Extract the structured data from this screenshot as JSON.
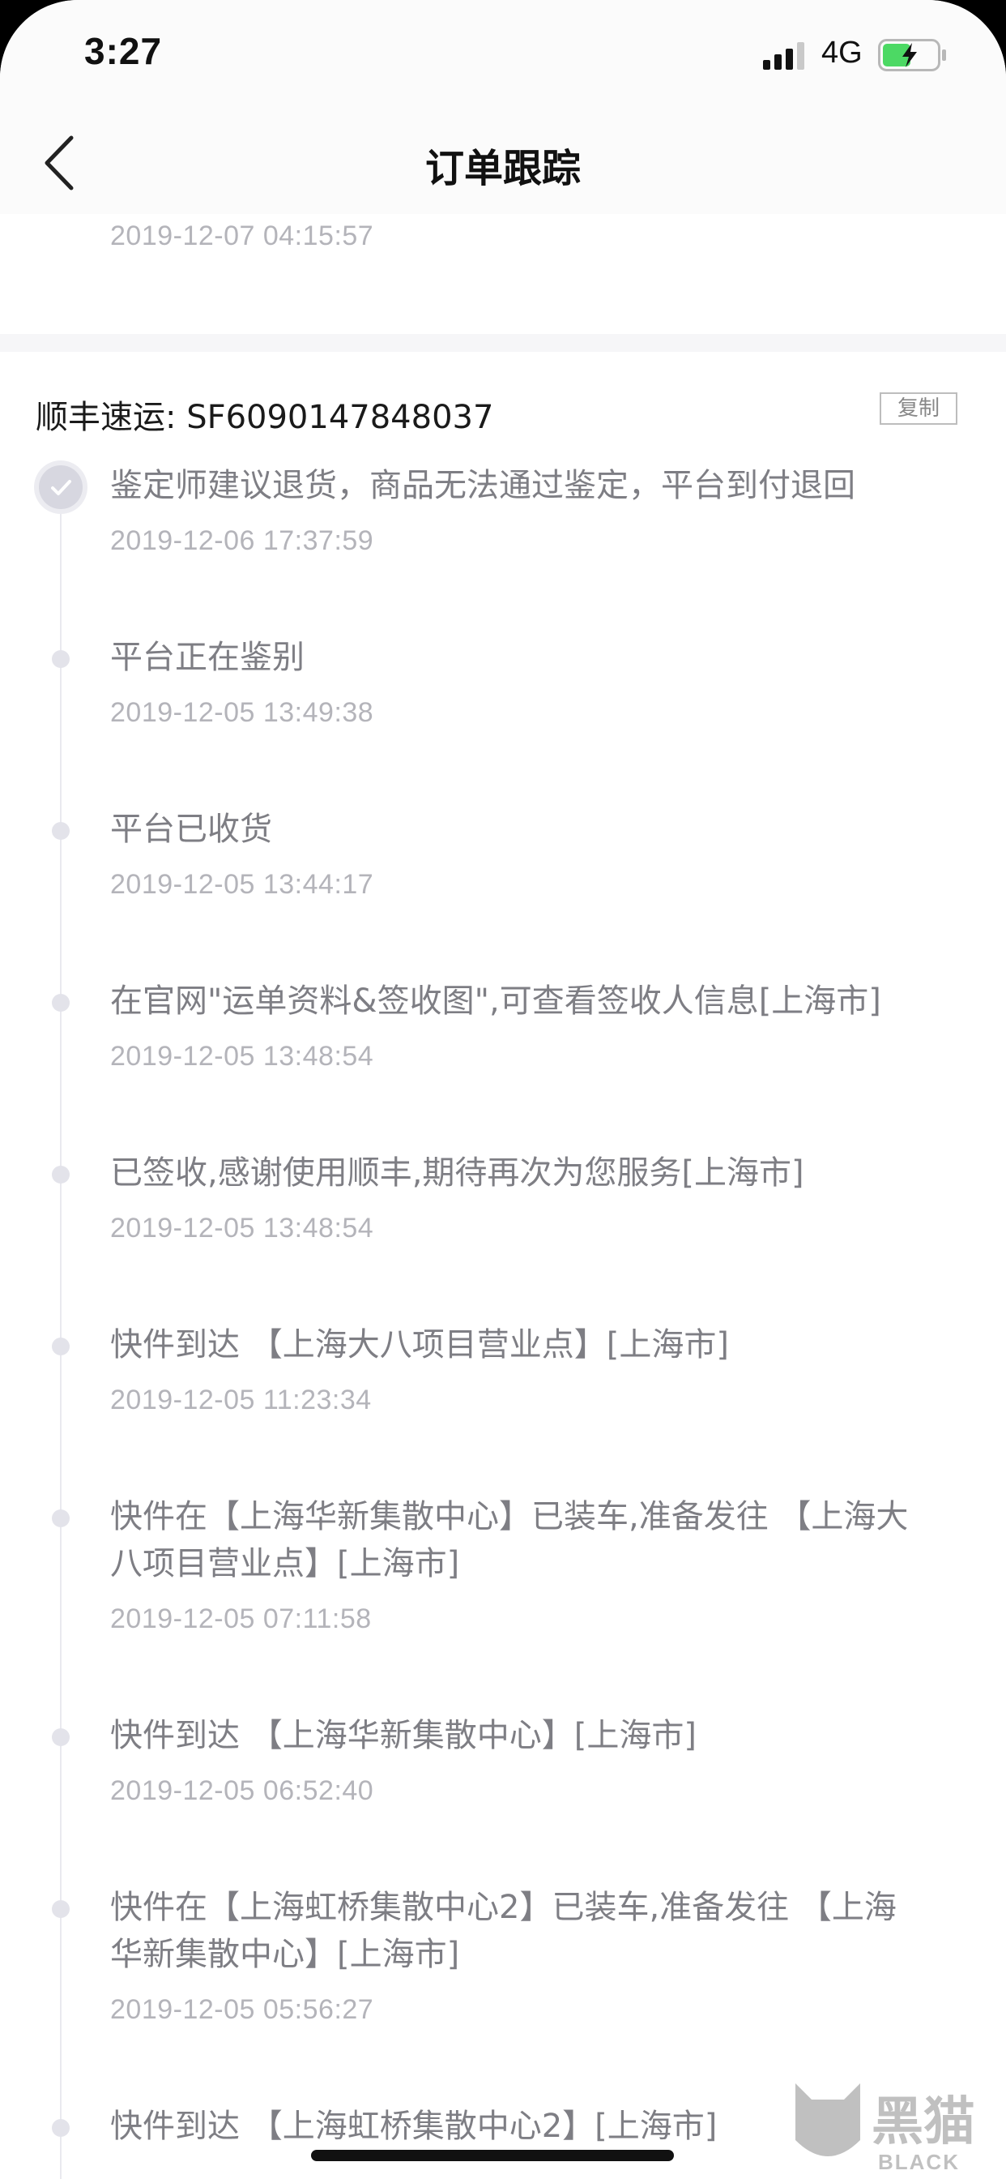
{
  "status_bar": {
    "time": "3:27",
    "network": "4G"
  },
  "nav": {
    "title": "订单跟踪"
  },
  "partial_group": {
    "last_event_time": "2019-12-07 04:15:57"
  },
  "shipment": {
    "carrier_label": "顺丰速运: SF6090147848037",
    "copy_label": "复制",
    "events": [
      {
        "desc": "鉴定师建议退货，商品无法通过鉴定，平台到付退回",
        "time": "2019-12-06 17:37:59"
      },
      {
        "desc": "平台正在鉴别",
        "time": "2019-12-05 13:49:38"
      },
      {
        "desc": "平台已收货",
        "time": "2019-12-05 13:44:17"
      },
      {
        "desc": "在官网\"运单资料&签收图\",可查看签收人信息[上海市]",
        "time": "2019-12-05 13:48:54"
      },
      {
        "desc": "已签收,感谢使用顺丰,期待再次为您服务[上海市]",
        "time": "2019-12-05 13:48:54"
      },
      {
        "desc": "快件到达 【上海大八项目营业点】[上海市]",
        "time": "2019-12-05 11:23:34"
      },
      {
        "desc": "快件在【上海华新集散中心】已装车,准备发往 【上海大八项目营业点】[上海市]",
        "time": "2019-12-05 07:11:58"
      },
      {
        "desc": "快件到达 【上海华新集散中心】[上海市]",
        "time": "2019-12-05 06:52:40"
      },
      {
        "desc": "快件在【上海虹桥集散中心2】已装车,准备发往 【上海华新集散中心】[上海市]",
        "time": "2019-12-05 05:56:27"
      },
      {
        "desc": "快件到达 【上海虹桥集散中心2】[上海市]",
        "time": ""
      }
    ]
  },
  "watermark": {
    "text": "黑猫",
    "sub": "BLACK"
  },
  "colors": {
    "text_primary": "#1a1a1a",
    "text_secondary": "#7e7e84",
    "text_time": "#b4b4ba",
    "divider": "#f6f6f8",
    "timeline": "#e9e9ef"
  }
}
